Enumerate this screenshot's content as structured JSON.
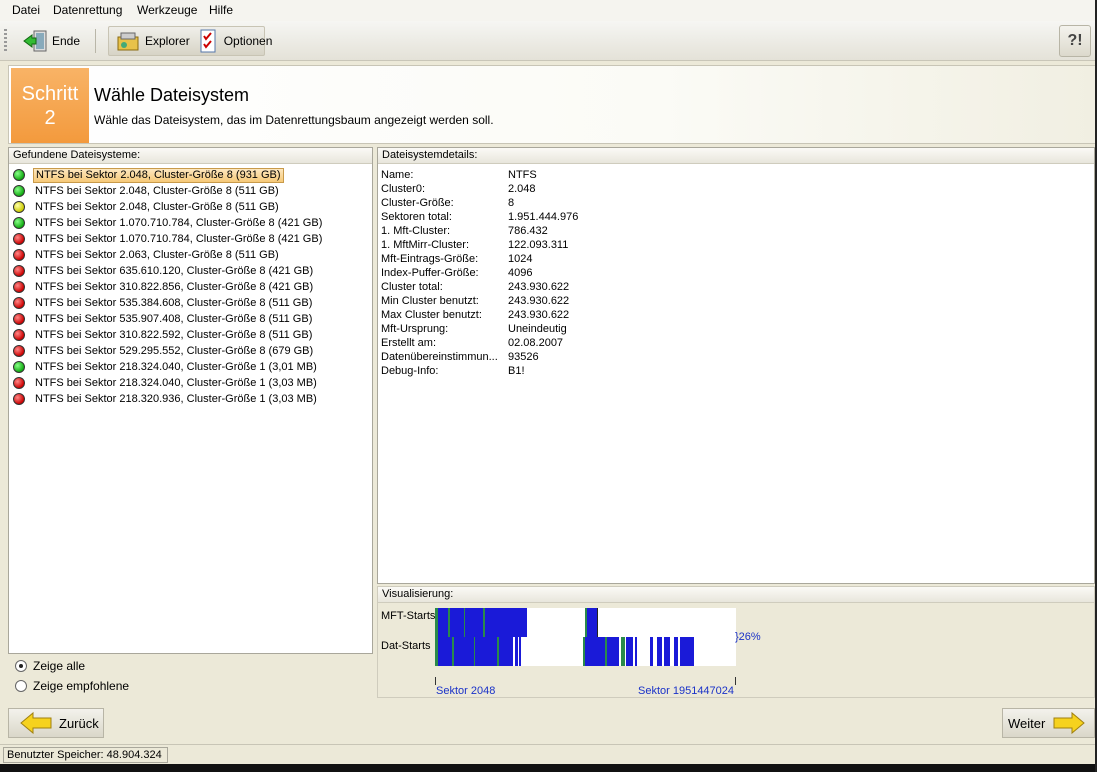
{
  "menu": [
    {
      "label": "Datei",
      "mnemonic": "D"
    },
    {
      "label": "Datenrettung",
      "mnemonic": "a"
    },
    {
      "label": "Werkzeuge",
      "mnemonic": "W"
    },
    {
      "label": "Hilfe",
      "mnemonic": "H"
    }
  ],
  "toolbar": {
    "ende_label": "Ende",
    "explorer_label": "Explorer",
    "optionen_label": "Optionen",
    "help_symbol": "?!"
  },
  "header": {
    "step_word": "Schritt",
    "step_number": "2",
    "title": "Wähle Dateisystem",
    "subtitle": "Wähle das Dateisystem, das im Datenrettungsbaum angezeigt werden soll."
  },
  "left_panel": {
    "title": "Gefundene Dateisysteme:",
    "items": [
      {
        "status": "green",
        "label": "NTFS bei Sektor 2.048, Cluster-Größe 8 (931 GB)",
        "selected": true
      },
      {
        "status": "green",
        "label": "NTFS bei Sektor 2.048, Cluster-Größe 8 (511 GB)"
      },
      {
        "status": "yellow",
        "label": "NTFS bei Sektor 2.048, Cluster-Größe 8 (511 GB)"
      },
      {
        "status": "green",
        "label": "NTFS bei Sektor 1.070.710.784, Cluster-Größe 8 (421 GB)"
      },
      {
        "status": "red",
        "label": "NTFS bei Sektor 1.070.710.784, Cluster-Größe 8 (421 GB)"
      },
      {
        "status": "red",
        "label": "NTFS bei Sektor 2.063, Cluster-Größe 8 (511 GB)"
      },
      {
        "status": "red",
        "label": "NTFS bei Sektor 635.610.120, Cluster-Größe 8 (421 GB)"
      },
      {
        "status": "red",
        "label": "NTFS bei Sektor 310.822.856, Cluster-Größe 8 (421 GB)"
      },
      {
        "status": "red",
        "label": "NTFS bei Sektor 535.384.608, Cluster-Größe 8 (511 GB)"
      },
      {
        "status": "red",
        "label": "NTFS bei Sektor 535.907.408, Cluster-Größe 8 (511 GB)"
      },
      {
        "status": "red",
        "label": "NTFS bei Sektor 310.822.592, Cluster-Größe 8 (511 GB)"
      },
      {
        "status": "red",
        "label": "NTFS bei Sektor 529.295.552, Cluster-Größe 8 (679 GB)"
      },
      {
        "status": "green",
        "label": "NTFS bei Sektor 218.324.040, Cluster-Größe 1 (3,01 MB)"
      },
      {
        "status": "red",
        "label": "NTFS bei Sektor 218.324.040, Cluster-Größe 1 (3,03 MB)"
      },
      {
        "status": "red",
        "label": "NTFS bei Sektor 218.320.936, Cluster-Größe 1 (3,03 MB)"
      }
    ]
  },
  "filter": {
    "show_all": "Zeige alle",
    "show_recommended": "Zeige empfohlene",
    "selected": "show_all"
  },
  "details": {
    "title": "Dateisystemdetails:",
    "rows": [
      {
        "key": "Name:",
        "value": "NTFS"
      },
      {
        "key": "Cluster0:",
        "value": "2.048"
      },
      {
        "key": "Cluster-Größe:",
        "value": "8"
      },
      {
        "key": "Sektoren total:",
        "value": "1.951.444.976"
      },
      {
        "key": "1. Mft-Cluster:",
        "value": "786.432"
      },
      {
        "key": "1. MftMirr-Cluster:",
        "value": "122.093.311"
      },
      {
        "key": "Mft-Eintrags-Größe:",
        "value": "1024"
      },
      {
        "key": "Index-Puffer-Größe:",
        "value": "4096"
      },
      {
        "key": "Cluster total:",
        "value": "243.930.622"
      },
      {
        "key": "Min Cluster benutzt:",
        "value": "243.930.622"
      },
      {
        "key": "Max Cluster benutzt:",
        "value": "243.930.622"
      },
      {
        "key": "Mft-Ursprung:",
        "value": "Uneindeutig"
      },
      {
        "key": "Erstellt am:",
        "value": "02.08.2007"
      },
      {
        "key": "Datenübereinstimmun...",
        "value": "93526"
      },
      {
        "key": "Debug-Info:",
        "value": "B1!"
      }
    ]
  },
  "visualization": {
    "title": "Visualisierung:",
    "mft_label": "MFT-Starts",
    "dat_label": "Dat-Starts",
    "percent": "}26%",
    "start_label": "Sektor 2048",
    "end_label": "Sektor 1951447024"
  },
  "nav": {
    "back_label": "Zurück",
    "next_label": "Weiter"
  },
  "status": {
    "memory": "Benutzter Speicher: 48.904.324"
  },
  "colors": {
    "step_orange": "#f39a3d",
    "bar_blue": "#1a1ad8",
    "bar_green": "#2a8a4a",
    "link_blue": "#1a32c8"
  }
}
